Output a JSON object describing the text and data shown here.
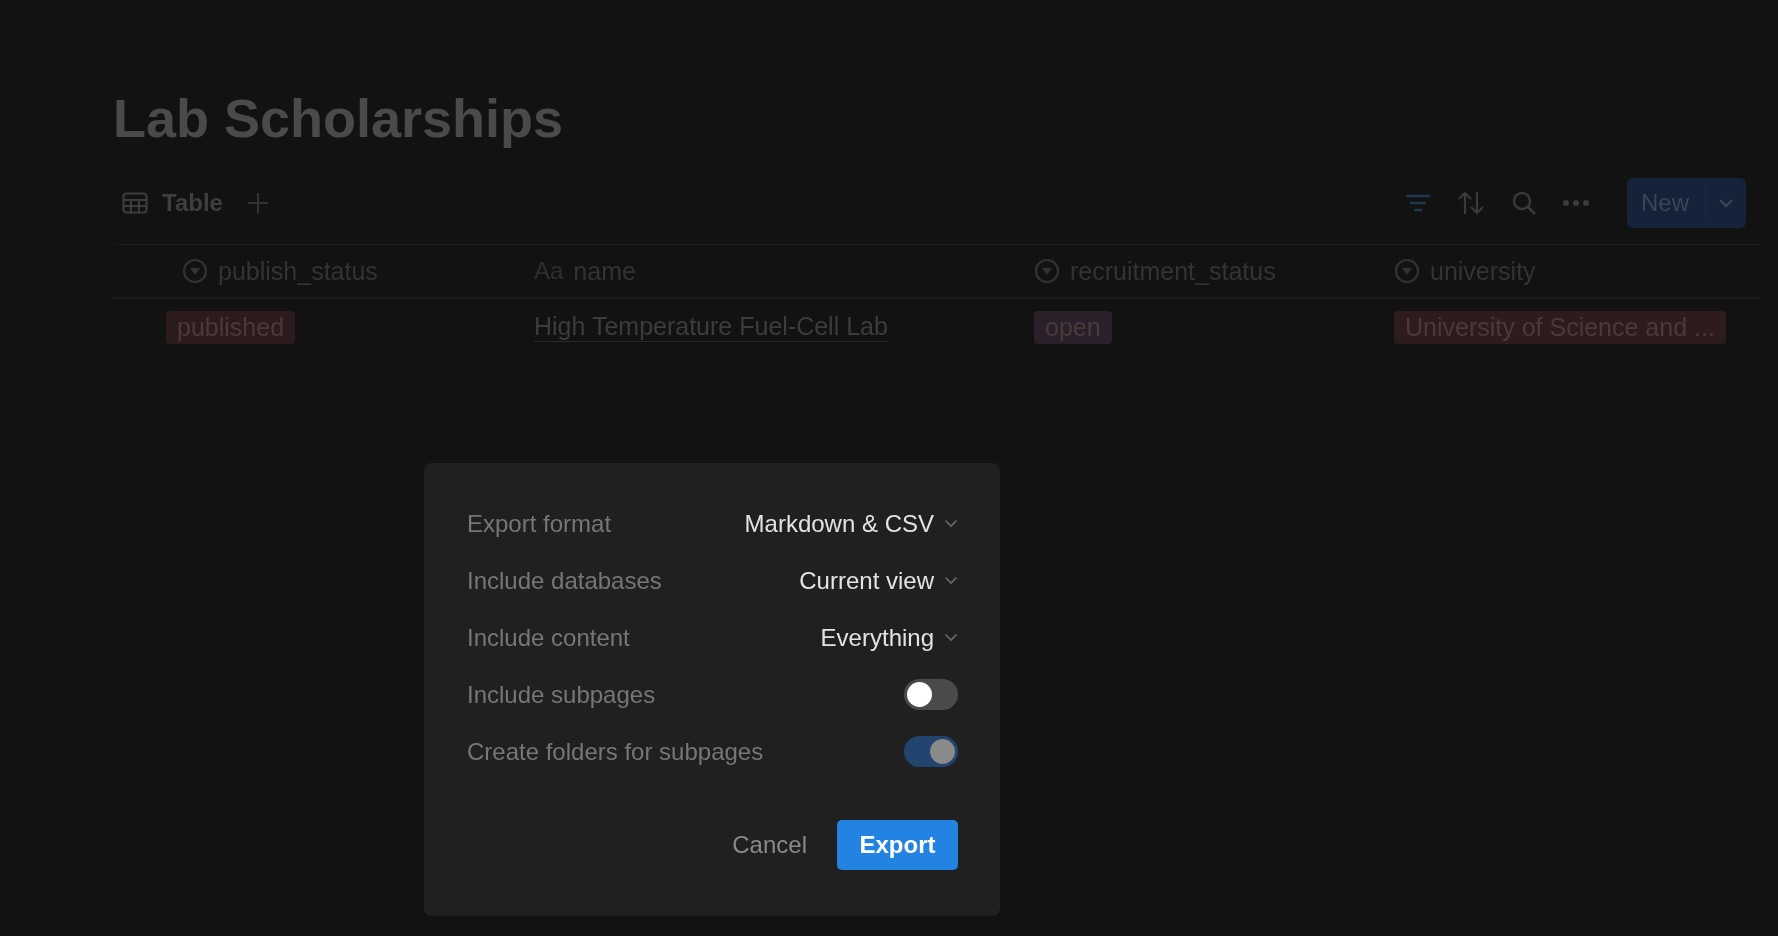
{
  "page": {
    "title": "Lab Scholarships"
  },
  "views": [
    {
      "label": "Table",
      "selected": true
    }
  ],
  "toolbar": {
    "new_button": "New"
  },
  "table": {
    "columns": [
      {
        "kind": "select",
        "label": "publish_status"
      },
      {
        "kind": "title",
        "prefix": "Aa",
        "label": "name"
      },
      {
        "kind": "select",
        "label": "recruitment_status"
      },
      {
        "kind": "select",
        "label": "university"
      }
    ],
    "rows": [
      [
        {
          "kind": "tag",
          "text": "published",
          "color": "#2c1b1d"
        },
        {
          "kind": "text",
          "text": "High Temperature Fuel-Cell Lab"
        },
        {
          "kind": "tag",
          "text": "open",
          "color": "#2a2029"
        },
        {
          "kind": "tag",
          "text": "University of Science and ...",
          "color": "#2e1b1b"
        }
      ]
    ]
  },
  "export_dialog": {
    "options": [
      {
        "kind": "dropdown",
        "label": "Export format",
        "value": "Markdown & CSV"
      },
      {
        "kind": "dropdown",
        "label": "Include databases",
        "value": "Current view"
      },
      {
        "kind": "dropdown",
        "label": "Include content",
        "value": "Everything"
      },
      {
        "kind": "toggle",
        "label": "Include subpages",
        "on": false,
        "disabled": false
      },
      {
        "kind": "toggle",
        "label": "Create folders for subpages",
        "on": true,
        "disabled": true
      }
    ],
    "buttons": [
      {
        "kind": "secondary",
        "label": "Cancel"
      },
      {
        "kind": "primary",
        "label": "Export"
      }
    ]
  }
}
